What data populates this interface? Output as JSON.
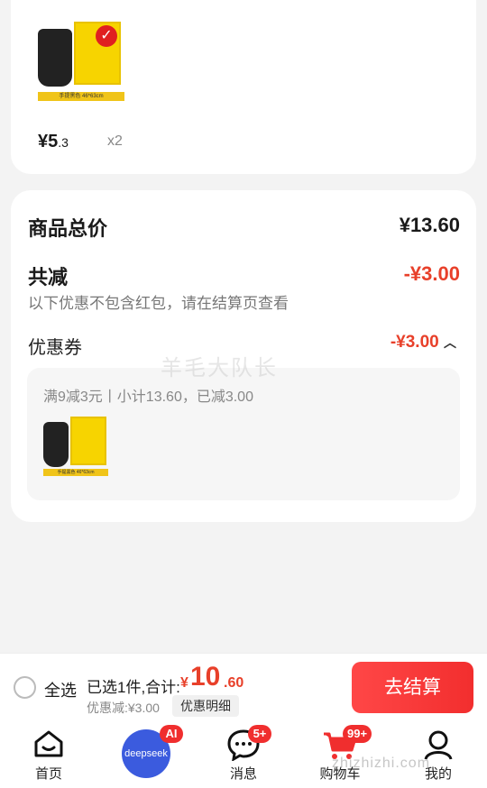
{
  "product": {
    "pack_text": "手提黑色 46*63cm",
    "price_symbol": "¥",
    "price_int": "5",
    "price_dec": ".3",
    "quantity": "x2"
  },
  "summary": {
    "total_label": "商品总价",
    "total_value": "¥13.60",
    "reduce_label": "共减",
    "reduce_value": "-¥3.00",
    "note": "以下优惠不包含红包，请在结算页查看",
    "coupon_label": "优惠券",
    "coupon_value": "-¥3.00",
    "coupon_desc": "满9减3元丨小计13.60，已减3.00"
  },
  "watermark": "羊毛大队长",
  "bottom_bar": {
    "select_all": "全选",
    "selected_text": "已选1件,合计:",
    "total_symbol": "¥",
    "total_int": "10",
    "total_dec": ".60",
    "discount_text": "优惠减:¥3.00",
    "detail_button": "优惠明细",
    "checkout_button": "去结算"
  },
  "tabbar": {
    "home": "首页",
    "deepseek": "deepseek",
    "ai_badge": "AI",
    "messages": "消息",
    "messages_badge": "5+",
    "cart": "购物车",
    "cart_badge": "99+",
    "me": "我的"
  },
  "bottom_watermark": "zhizhizhi.com",
  "colors": {
    "accent": "#e8402a",
    "checkout": "#f22e2e",
    "deepseek": "#3b5bde"
  }
}
